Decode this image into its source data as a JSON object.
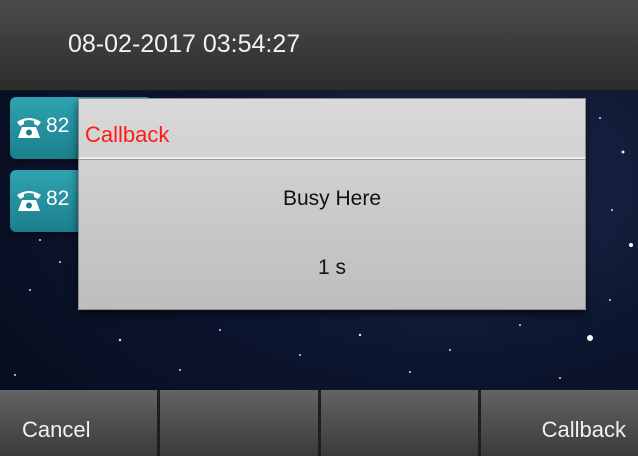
{
  "status_bar": {
    "datetime": "08-02-2017 03:54:27"
  },
  "line_keys": [
    {
      "label": "82",
      "icon": "phone-icon"
    },
    {
      "label": "82",
      "icon": "phone-icon"
    }
  ],
  "dialog": {
    "title": "Callback",
    "title_color": "#ff1a1a",
    "message": "Busy Here",
    "countdown": "1 s"
  },
  "softkeys": [
    {
      "label": "Cancel"
    },
    {
      "label": ""
    },
    {
      "label": ""
    },
    {
      "label": "Callback"
    }
  ]
}
